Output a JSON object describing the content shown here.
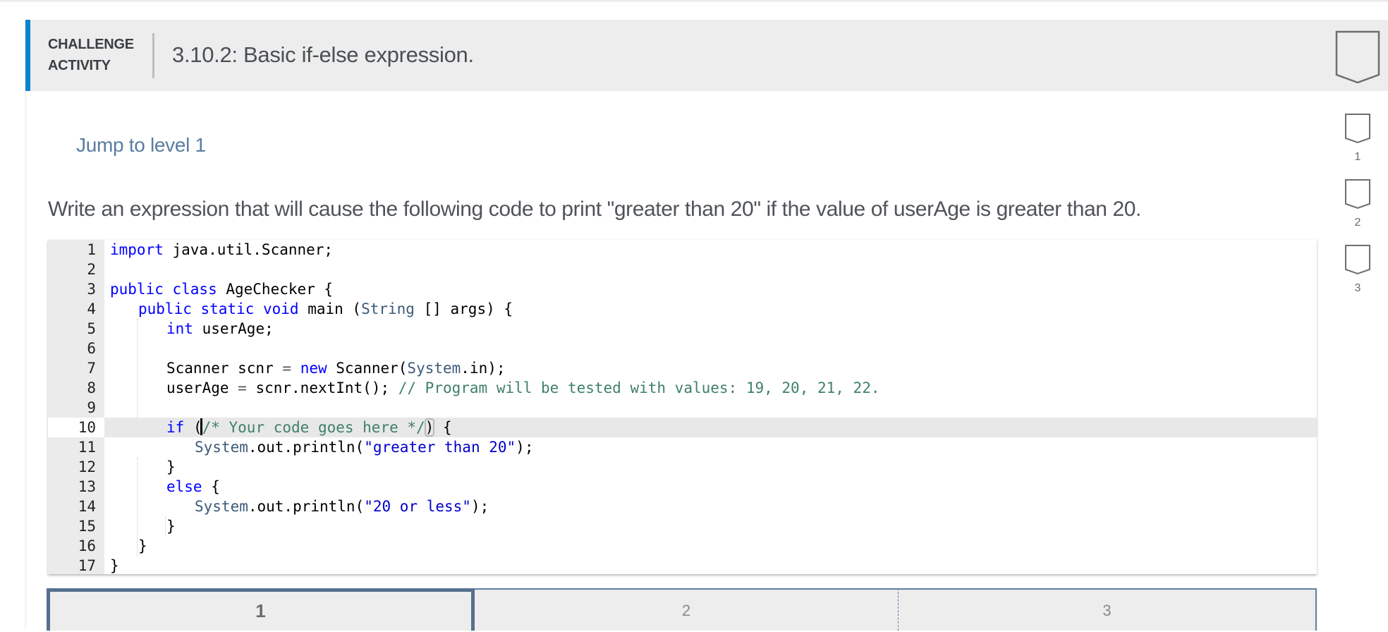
{
  "header": {
    "kind_line1": "CHALLENGE",
    "kind_line2": "ACTIVITY",
    "title": "3.10.2: Basic if-else expression."
  },
  "jump_link": "Jump to level 1",
  "instructions": "Write an expression that will cause the following code to print \"greater than 20\" if the value of userAge is greater than 20.",
  "level_badges": [
    {
      "label": "1",
      "completed": false
    },
    {
      "label": "2",
      "completed": false
    },
    {
      "label": "3",
      "completed": false
    }
  ],
  "editor": {
    "active_line": 10,
    "lines": [
      {
        "n": "1"
      },
      {
        "n": "2"
      },
      {
        "n": "3"
      },
      {
        "n": "4"
      },
      {
        "n": "5"
      },
      {
        "n": "6"
      },
      {
        "n": "7"
      },
      {
        "n": "8"
      },
      {
        "n": "9"
      },
      {
        "n": "10"
      },
      {
        "n": "11"
      },
      {
        "n": "12"
      },
      {
        "n": "13"
      },
      {
        "n": "14"
      },
      {
        "n": "15"
      },
      {
        "n": "16"
      },
      {
        "n": "17"
      }
    ],
    "tokens": {
      "l1_kw": "import",
      "l1_rest": " java.util.Scanner;",
      "l3_kw": "public class",
      "l3_rest": " AgeChecker {",
      "l4_kw": "public static void",
      "l4_main": " main (",
      "l4_type": "String",
      "l4_rest": " [] args) {",
      "l5_kw": "int",
      "l5_rest": " userAge;",
      "l7_a": "Scanner scnr ",
      "l7_eq": "=",
      "l7_sp": " ",
      "l7_new": "new",
      "l7_b": " Scanner(",
      "l7_sys": "System",
      "l7_c": ".in);",
      "l8_a": "userAge ",
      "l8_eq": "=",
      "l8_b": " scnr.nextInt(); ",
      "l8_comment": "// Program will be tested with values: 19, 20, 21, 22.",
      "l10_if": "if",
      "l10_paren": " (",
      "l10_comment": "/* Your code goes here */",
      "l10_close": ")",
      "l10_rest": " {",
      "l11_sys": "System",
      "l11_a": ".out.println(",
      "l11_str": "\"greater than 20\"",
      "l11_b": ");",
      "l12": "}",
      "l13_kw": "else",
      "l13_rest": " {",
      "l14_sys": "System",
      "l14_a": ".out.println(",
      "l14_str": "\"20 or less\"",
      "l14_b": ");",
      "l15": "}",
      "l16": "}",
      "l17": "}"
    }
  },
  "level_tabs": [
    {
      "label": "1",
      "active": true
    },
    {
      "label": "2",
      "active": false
    },
    {
      "label": "3",
      "active": false
    }
  ]
}
